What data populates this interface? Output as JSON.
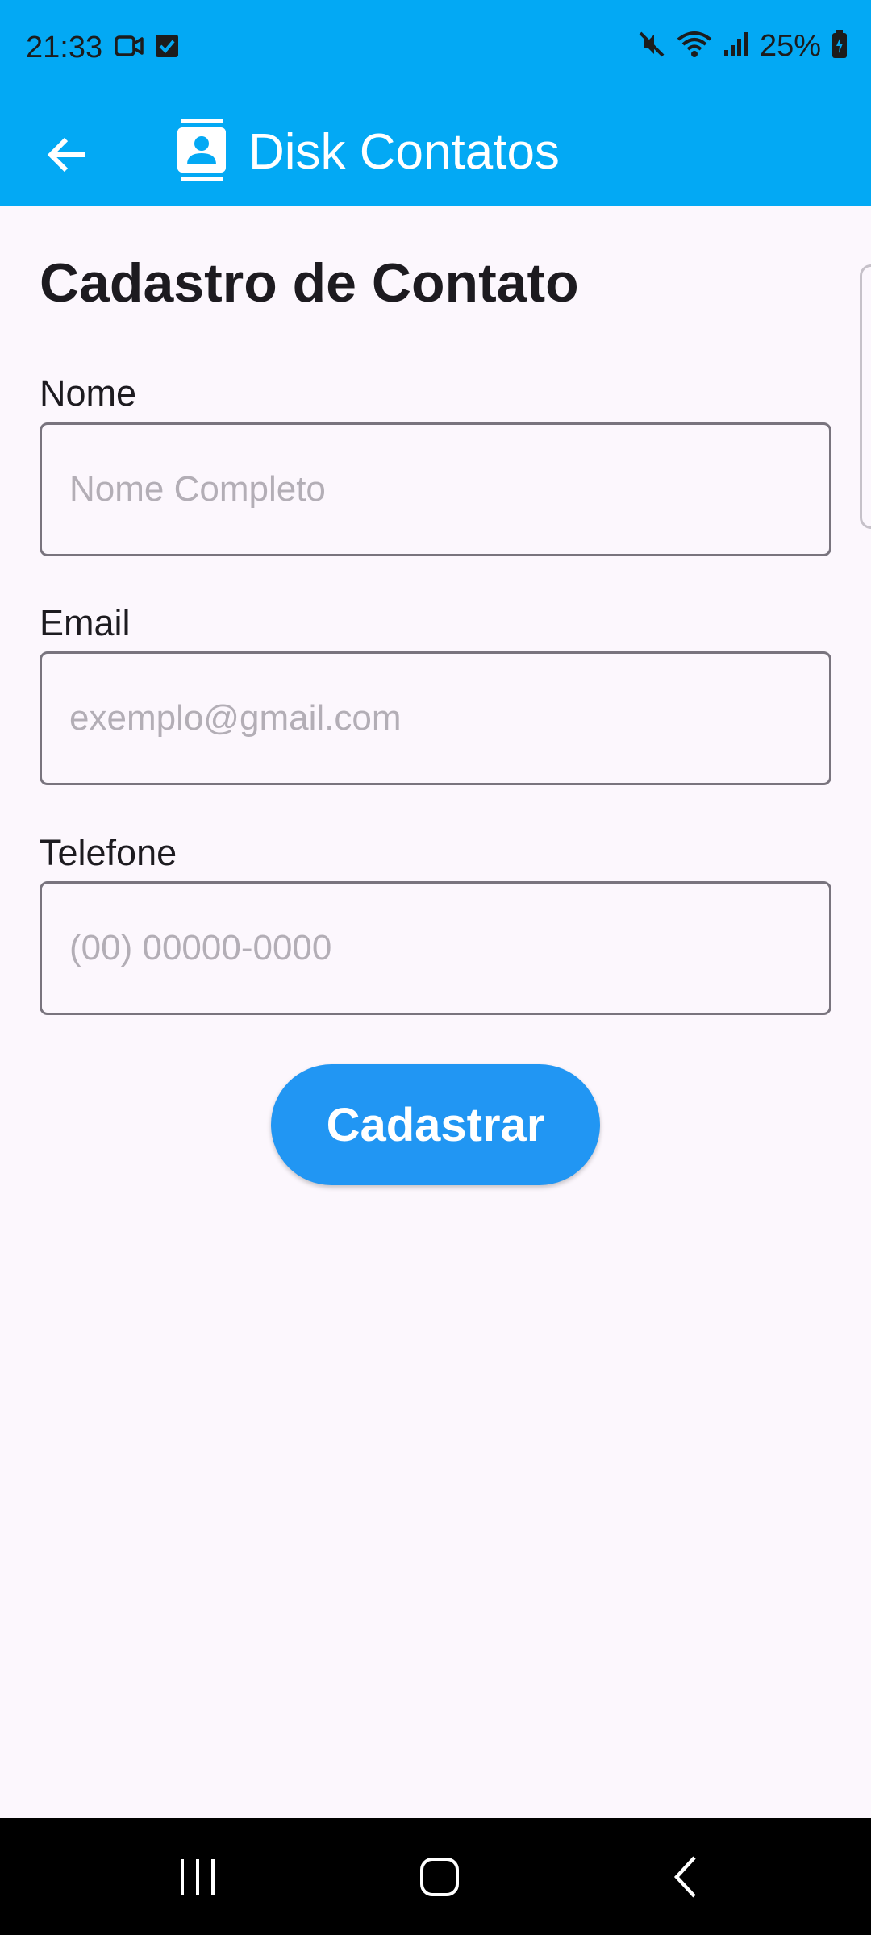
{
  "status_bar": {
    "time": "21:33",
    "battery": "25%",
    "icons": [
      "video-camera-icon",
      "checkbox-icon",
      "mute-icon",
      "wifi-icon",
      "signal-icon",
      "battery-icon"
    ]
  },
  "app_bar": {
    "title": "Disk Contatos",
    "back_icon": "arrow-back-icon",
    "logo_icon": "contact-card-icon",
    "color": "#03a9f4"
  },
  "form": {
    "title": "Cadastro de Contato",
    "fields": [
      {
        "label": "Nome",
        "value": "",
        "placeholder": "Nome Completo"
      },
      {
        "label": "Email",
        "value": "",
        "placeholder": "exemplo@gmail.com"
      },
      {
        "label": "Telefone",
        "value": "",
        "placeholder": "(00) 00000-0000"
      }
    ],
    "submit_label": "Cadastrar",
    "submit_color": "#2196f3"
  },
  "nav_bar": {
    "recent_icon": "recent-apps-icon",
    "home_icon": "home-icon",
    "back_icon": "nav-back-icon"
  }
}
